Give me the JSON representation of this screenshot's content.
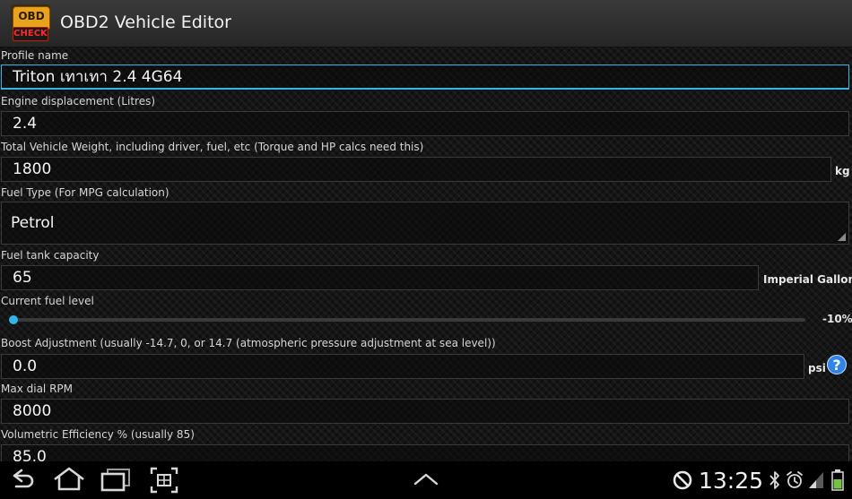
{
  "app": {
    "title": "OBD2 Vehicle Editor",
    "icon_top_text": "OBD",
    "icon_bottom_text": "CHECK"
  },
  "form": {
    "profile_name": {
      "label": "Profile name",
      "value": "Triton เทาเทา 2.4 4G64"
    },
    "engine_displacement": {
      "label": "Engine displacement (Litres)",
      "value": "2.4"
    },
    "vehicle_weight": {
      "label": "Total Vehicle Weight, including driver, fuel, etc (Torque and HP calcs need this)",
      "value": "1800",
      "unit": "kg"
    },
    "fuel_type": {
      "label": "Fuel Type (For MPG calculation)",
      "value": "Petrol"
    },
    "fuel_tank_capacity": {
      "label": "Fuel tank capacity",
      "value": "65",
      "unit": "Imperial Gallons"
    },
    "current_fuel_level": {
      "label": "Current fuel level",
      "value_text": "-10%",
      "fraction": 0.0
    },
    "boost_adjustment": {
      "label": "Boost Adjustment (usually -14.7, 0, or 14.7 (atmospheric pressure adjustment at sea level))",
      "value": "0.0",
      "unit": "psi"
    },
    "max_dial_rpm": {
      "label": "Max dial RPM",
      "value": "8000"
    },
    "volumetric_efficiency": {
      "label": "Volumetric Efficiency % (usually 85)",
      "value": "85.0"
    }
  },
  "statusbar": {
    "time": "13:25"
  },
  "colors": {
    "accent": "#33b5e5",
    "help": "#2f84e8"
  }
}
